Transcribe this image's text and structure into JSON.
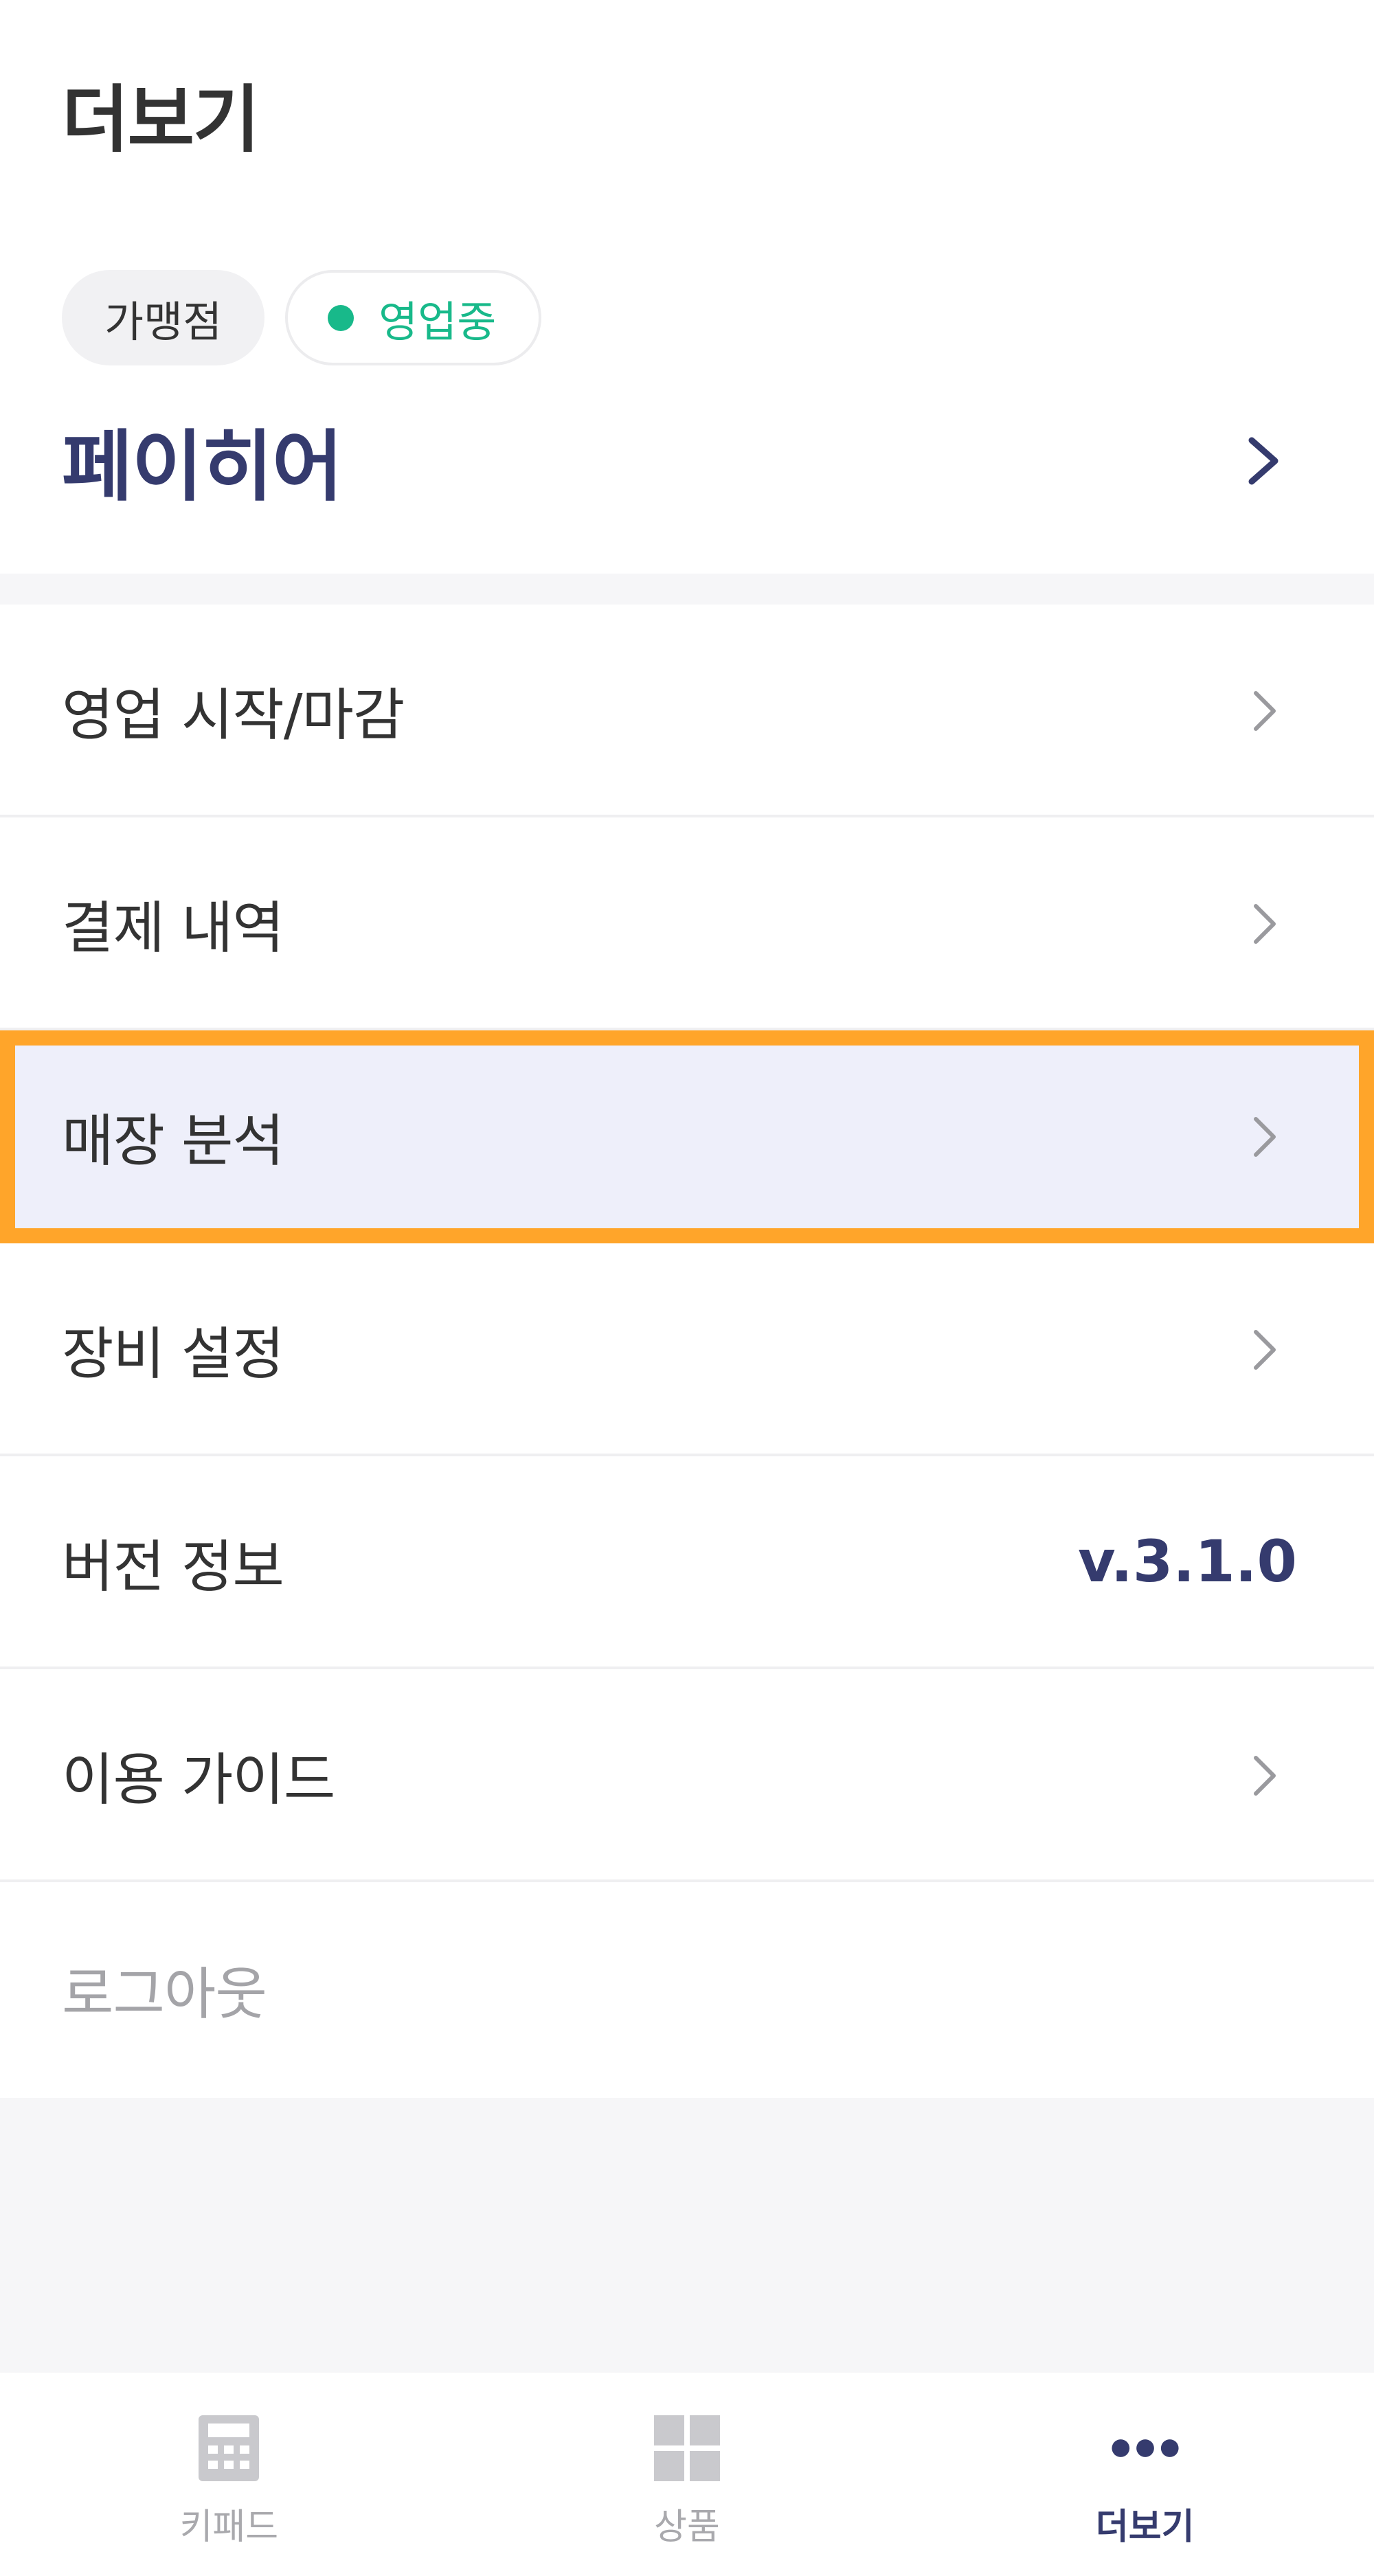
{
  "header": {
    "title": "더보기"
  },
  "store": {
    "type_badge": "가맹점",
    "status_badge": "영업중",
    "name": "페이히어",
    "colors": {
      "brand": "#353b6e",
      "status": "#18b98a"
    }
  },
  "menu": {
    "items": [
      {
        "label": "영업 시작/마감",
        "icon": "chevron-right-icon"
      },
      {
        "label": "결제 내역",
        "icon": "chevron-right-icon"
      },
      {
        "label": "매장 분석",
        "icon": "chevron-right-icon",
        "highlighted": true
      },
      {
        "label": "장비 설정",
        "icon": "chevron-right-icon"
      },
      {
        "label": "버전 정보",
        "value": "v.3.1.0"
      },
      {
        "label": "이용 가이드",
        "icon": "chevron-right-icon"
      },
      {
        "label": "로그아웃"
      }
    ],
    "highlight_color": "#ffa52a"
  },
  "tabbar": {
    "tabs": [
      {
        "label": "키패드",
        "icon": "calculator-icon"
      },
      {
        "label": "상품",
        "icon": "grid-icon"
      },
      {
        "label": "더보기",
        "icon": "more-dots-icon",
        "active": true
      }
    ]
  }
}
